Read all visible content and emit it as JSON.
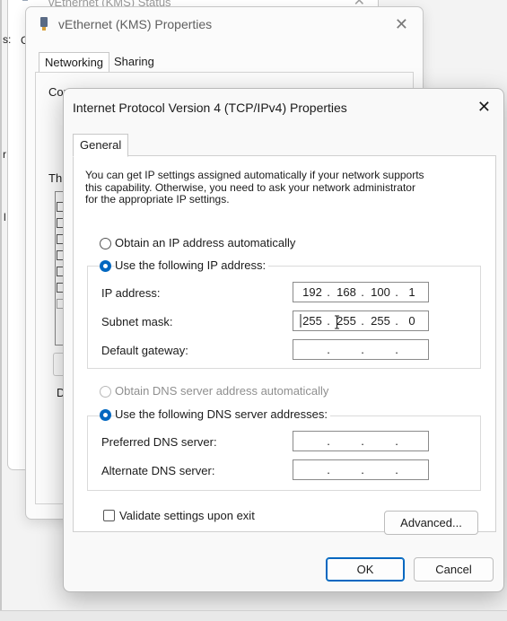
{
  "status_window": {
    "title": "vEthernet (KMS) Status",
    "close_glyph": "✕"
  },
  "bg_fragments": {
    "f1": "s:",
    "f2": "G",
    "f3": "r",
    "f4": "l"
  },
  "props_window": {
    "title": "vEthernet (KMS) Properties",
    "close_glyph": "✕",
    "tabs": [
      "Networking",
      "Sharing"
    ],
    "connect_fragment": "Cor",
    "this_fragment": "Thi",
    "desc_fragment": "D"
  },
  "dialog": {
    "title": "Internet Protocol Version 4 (TCP/IPv4) Properties",
    "close_glyph": "✕",
    "tab": "General",
    "intro_lines": [
      "You can get IP settings assigned automatically if your network supports",
      "this capability. Otherwise, you need to ask your network administrator",
      "for the appropriate IP settings."
    ],
    "ip_auto_label": "Obtain an IP address automatically",
    "ip_manual_label": "Use the following IP address:",
    "ip_mode": "manual",
    "fields": {
      "ip_address": {
        "label": "IP address:",
        "octets": [
          "192",
          "168",
          "100",
          "1"
        ]
      },
      "subnet_mask": {
        "label": "Subnet mask:",
        "octets": [
          "255",
          "255",
          "255",
          "0"
        ]
      },
      "default_gateway": {
        "label": "Default gateway:",
        "octets": [
          "",
          "",
          "",
          ""
        ]
      }
    },
    "dns_auto_label": "Obtain DNS server address automatically",
    "dns_manual_label": "Use the following DNS server addresses:",
    "dns_mode": "manual",
    "dns_fields": {
      "preferred": {
        "label": "Preferred DNS server:",
        "octets": [
          "",
          "",
          "",
          ""
        ]
      },
      "alternate": {
        "label": "Alternate DNS server:",
        "octets": [
          "",
          "",
          "",
          ""
        ]
      }
    },
    "validate_label": "Validate settings upon exit",
    "validate_checked": false,
    "advanced_label": "Advanced...",
    "ok_label": "OK",
    "cancel_label": "Cancel"
  },
  "colors": {
    "accent": "#0067c0",
    "disabled_text": "#8f8f8f"
  }
}
